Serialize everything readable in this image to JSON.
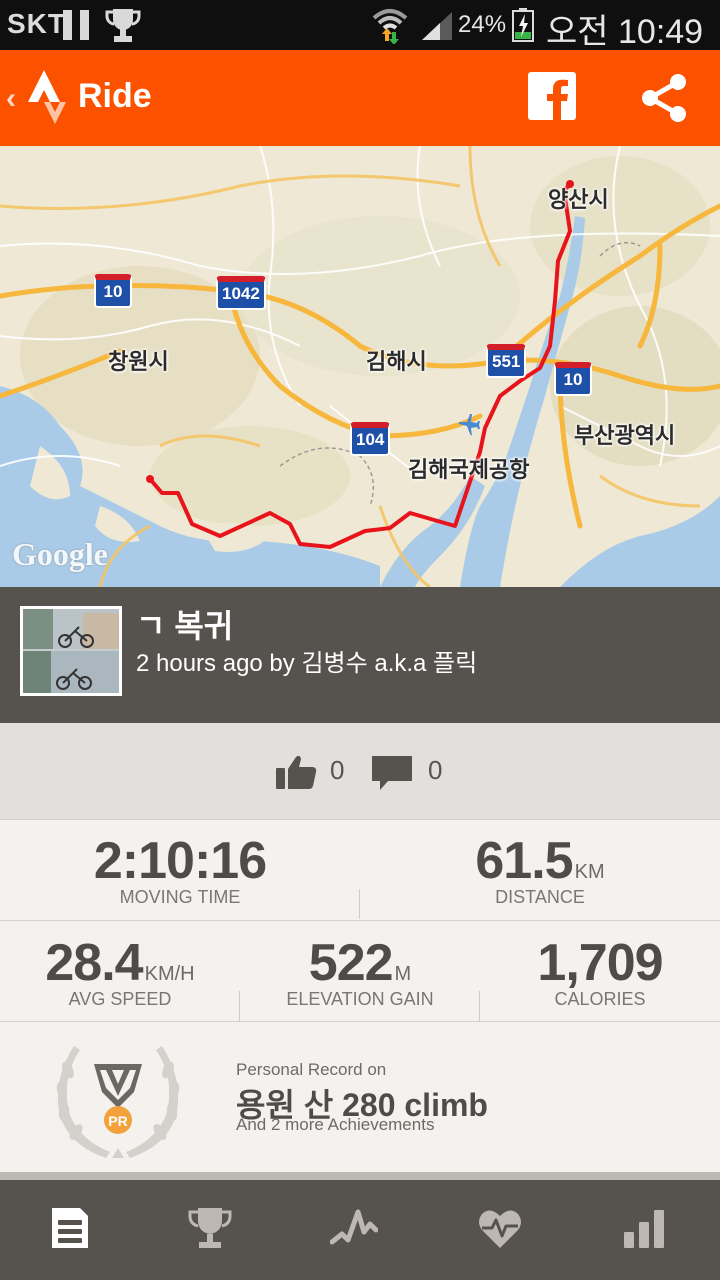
{
  "status_bar": {
    "carrier": "SKT",
    "battery_percent": "24%",
    "time": "오전 10:49",
    "icons": [
      "pause-icon",
      "trophy-icon",
      "wifi-icon",
      "signal-icon",
      "battery-icon"
    ]
  },
  "app_bar": {
    "title": "Ride",
    "icons": [
      "back-chevron-icon",
      "strava-logo-icon",
      "facebook-icon",
      "share-icon"
    ]
  },
  "map": {
    "places": [
      "양산시",
      "창원시",
      "김해시",
      "부산광역시",
      "김해국제공항"
    ],
    "route_shields": [
      "10",
      "1042",
      "551",
      "10",
      "104"
    ],
    "attribution": "Google",
    "route_color": "#e8141b"
  },
  "activity": {
    "name": "ㄱ 복귀",
    "meta": "2 hours ago by 김병수 a.k.a 플릭"
  },
  "social": {
    "kudos_count": "0",
    "comment_count": "0"
  },
  "stats": {
    "moving_time": {
      "value": "2:10:16",
      "unit": "",
      "label": "MOVING TIME"
    },
    "distance": {
      "value": "61.5",
      "unit": "KM",
      "label": "DISTANCE"
    },
    "avg_speed": {
      "value": "28.4",
      "unit": "KM/H",
      "label": "AVG SPEED"
    },
    "elevation_gain": {
      "value": "522",
      "unit": "M",
      "label": "ELEVATION GAIN"
    },
    "calories": {
      "value": "1,709",
      "unit": "",
      "label": "CALORIES"
    }
  },
  "achievement": {
    "badge": "PR",
    "heading": "Personal Record on",
    "segment": "용원 산 280 climb",
    "more": "And 2 more Achievements"
  },
  "bottom_nav": {
    "items": [
      "feed-icon",
      "trophy-icon",
      "activity-graph-icon",
      "heart-rate-icon",
      "stats-icon"
    ]
  },
  "colors": {
    "brand_orange": "#fc5200",
    "header_gray": "#56524e",
    "social_bg": "#e3dfdc",
    "stats_bg": "#f4f2ef"
  }
}
